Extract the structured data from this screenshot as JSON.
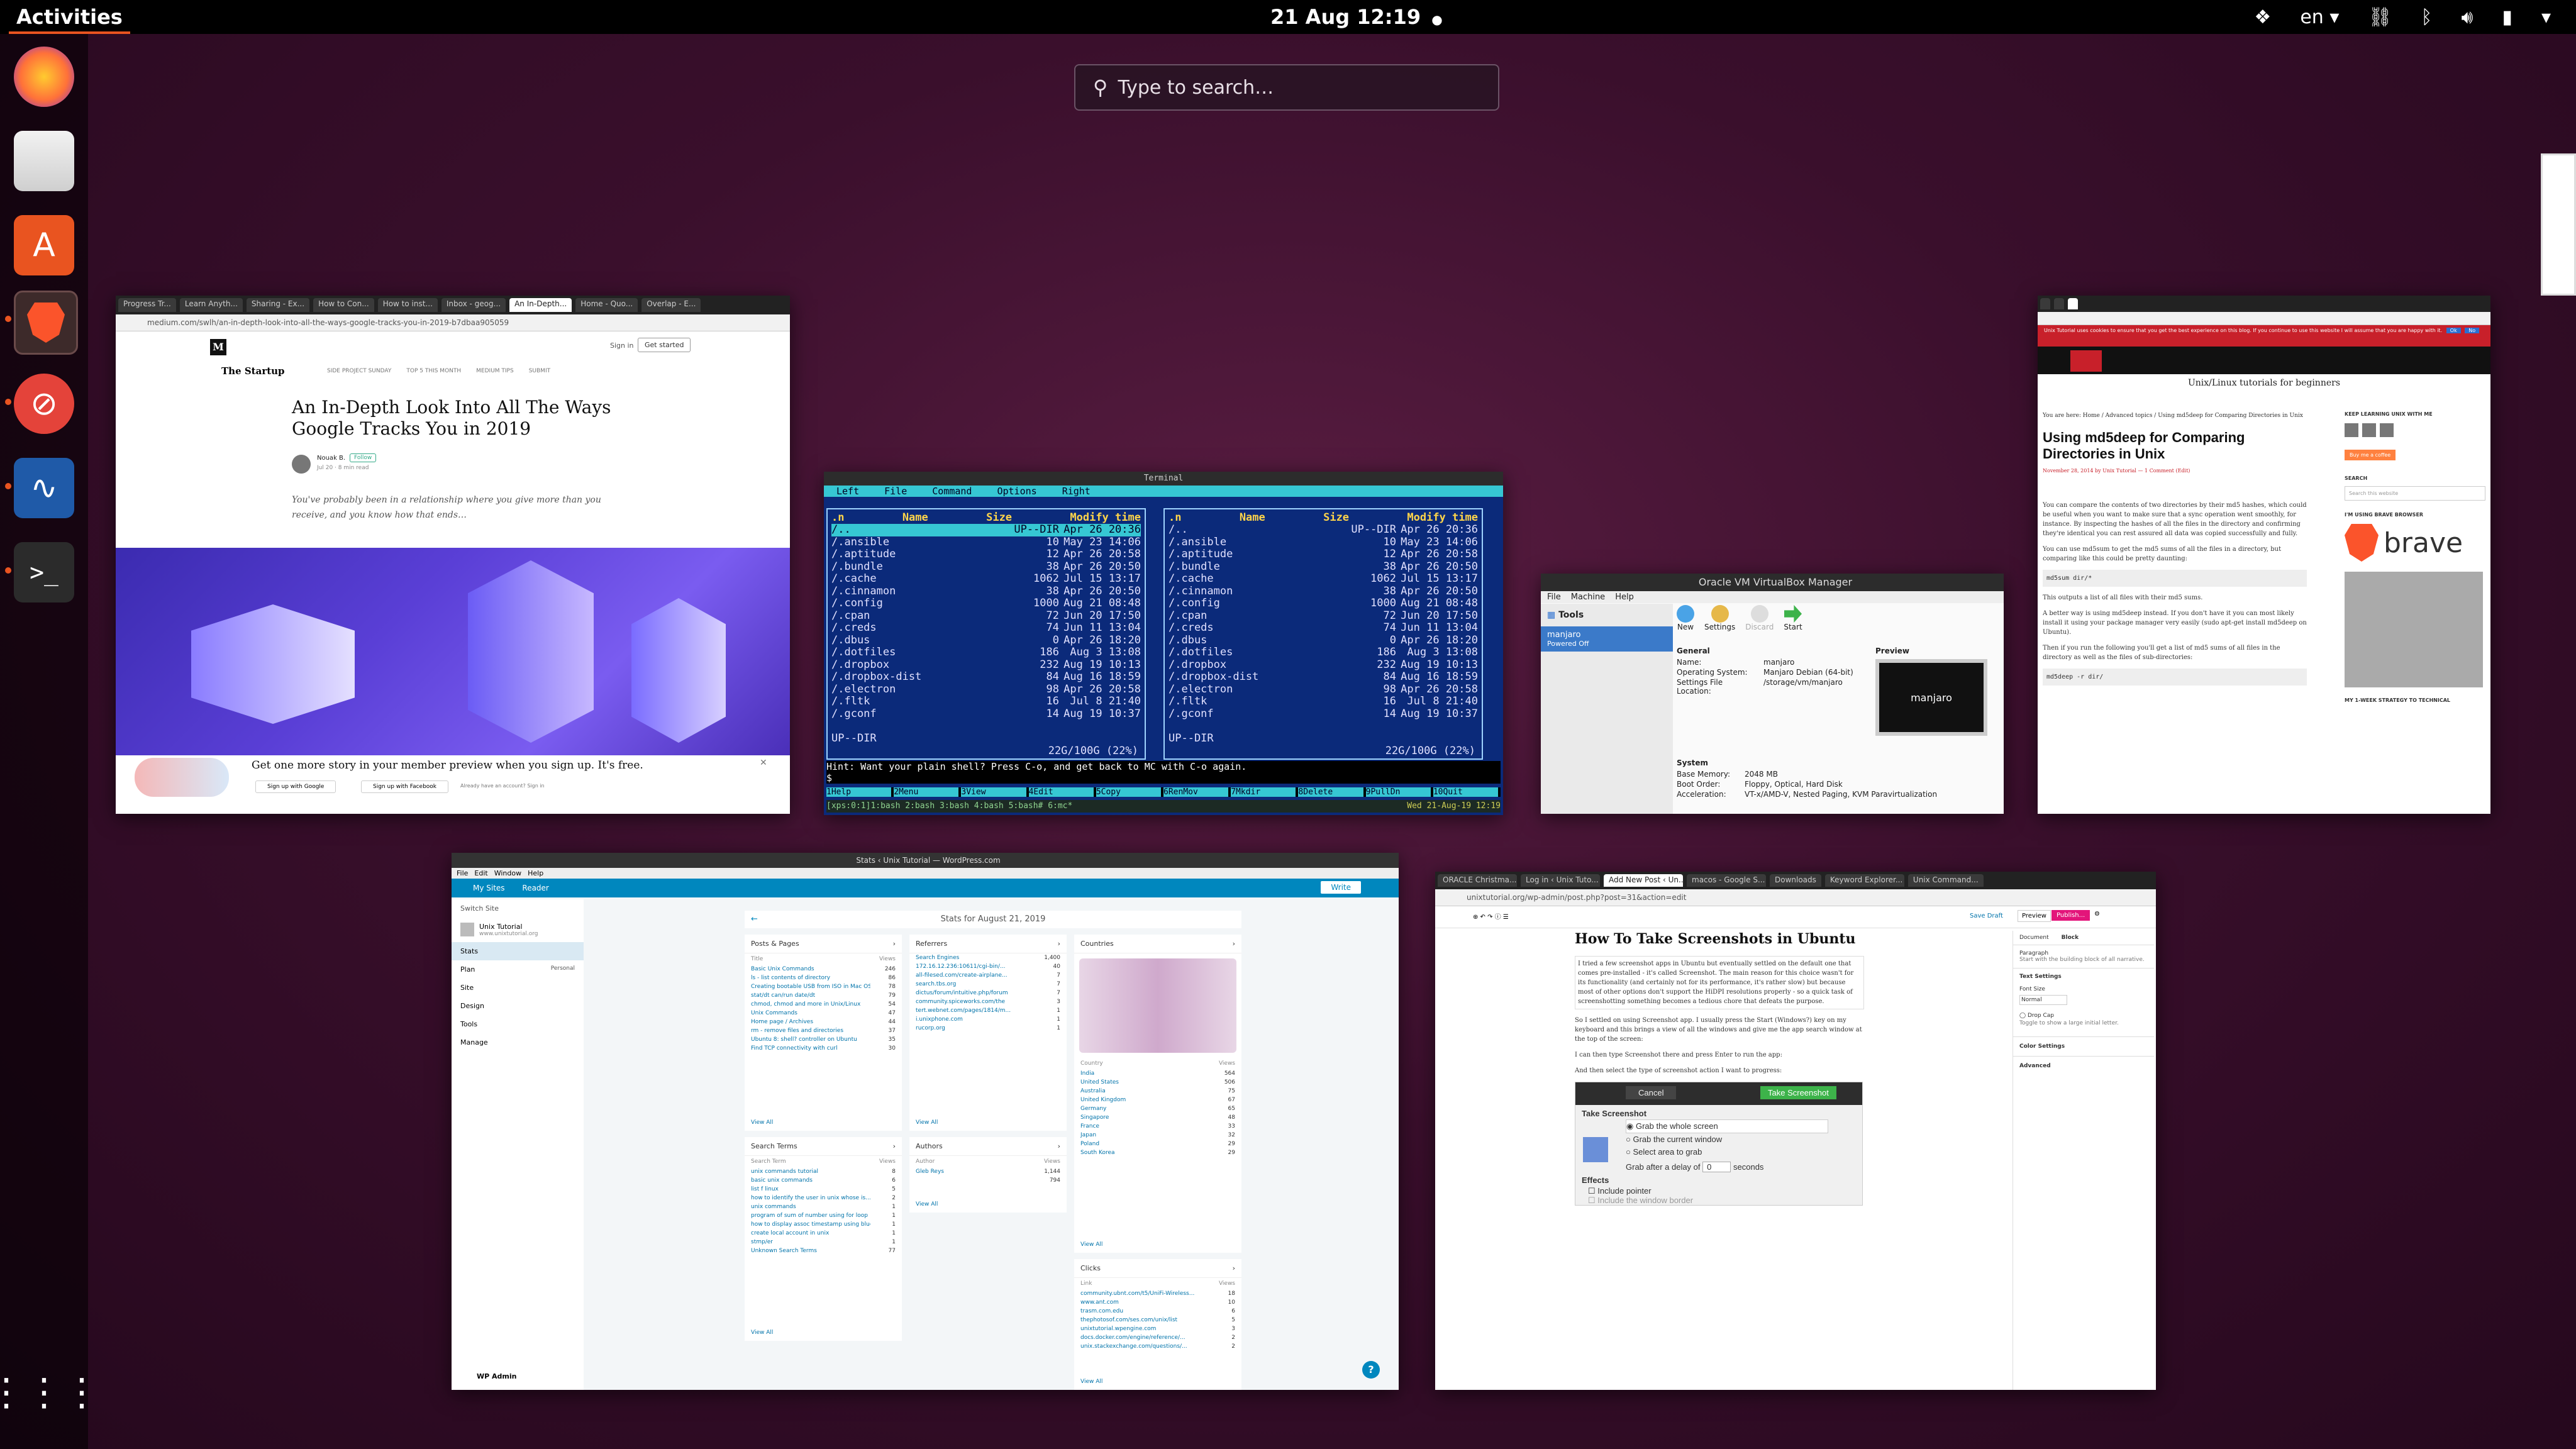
{
  "topbar": {
    "activities": "Activities",
    "clock": "21 Aug  12:19",
    "language": "en"
  },
  "search": {
    "placeholder": "Type to search…"
  },
  "dock": {
    "apps": [
      "firefox-icon",
      "files-icon",
      "software-icon",
      "brave-icon",
      "blocked-icon",
      "system-monitor-icon",
      "terminal-icon"
    ],
    "show_apps": "apps-grid-icon"
  },
  "medium_window": {
    "tabs": [
      "Progress Tr...",
      "Learn Anyth...",
      "Sharing - Ex...",
      "How to Con...",
      "How to inst...",
      "Inbox - geog...",
      "An In-Depth...",
      "Home - Quo...",
      "Overlap - E..."
    ],
    "url": "medium.com/swlh/an-in-depth-look-into-all-the-ways-google-tracks-you-in-2019-b7dbaa905059",
    "brand": "M",
    "publication": "The Startup",
    "nav": [
      "SIDE PROJECT SUNDAY",
      "TOP 5 THIS MONTH",
      "MEDIUM TIPS",
      "SUBMIT"
    ],
    "signin": "Sign in",
    "getstarted": "Get started",
    "title": "An In-Depth Look Into All The Ways Google Tracks You in 2019",
    "author": "Nouak B.",
    "follow": "Follow",
    "meta": "Jul 20 · 8 min read",
    "intro": "You've probably been in a relationship where you give more than you receive, and you know how that ends…",
    "banner": "Get one more story in your member preview when you sign up. It's free.",
    "google_btn": "Sign up with Google",
    "fb_btn": "Sign up with Facebook",
    "already": "Already have an account? Sign in"
  },
  "terminal": {
    "title": "Terminal",
    "menu": [
      "Left",
      "File",
      "Command",
      "Options",
      "Right"
    ],
    "headers": [
      ".n",
      "Name",
      "Size",
      "Modify time"
    ],
    "rows": [
      [
        "/..",
        "UP--DIR",
        "Apr 26 20:36"
      ],
      [
        "/.ansible",
        "10",
        "May 23 14:06"
      ],
      [
        "/.aptitude",
        "12",
        "Apr 26 20:58"
      ],
      [
        "/.bundle",
        "38",
        "Apr 26 20:50"
      ],
      [
        "/.cache",
        "1062",
        "Jul 15 13:17"
      ],
      [
        "/.cinnamon",
        "38",
        "Apr 26 20:50"
      ],
      [
        "/.config",
        "1000",
        "Aug 21 08:48"
      ],
      [
        "/.cpan",
        "72",
        "Jun 20 17:50"
      ],
      [
        "/.creds",
        "74",
        "Jun 11 13:04"
      ],
      [
        "/.dbus",
        "0",
        "Apr 26 18:20"
      ],
      [
        "/.dotfiles",
        "186",
        "Aug  3 13:08"
      ],
      [
        "/.dropbox",
        "232",
        "Aug 19 10:13"
      ],
      [
        "/.dropbox-dist",
        "84",
        "Aug 16 18:59"
      ],
      [
        "/.electron",
        "98",
        "Apr 26 20:58"
      ],
      [
        "/.fltk",
        "16",
        "Jul  8 21:40"
      ],
      [
        "/.gconf",
        "14",
        "Aug 19 10:37"
      ]
    ],
    "status_left": "UP--DIR",
    "disk": "22G/100G (22%)",
    "hint": "Hint: Want your plain shell? Press C-o, and get back to MC with C-o again.",
    "prompt": "$ ",
    "fkeys": [
      "1Help",
      "2Menu",
      "3View",
      "4Edit",
      "5Copy",
      "6RenMov",
      "7Mkdir",
      "8Delete",
      "9PullDn",
      "10Quit"
    ],
    "tmux": "[xps:0:1]1:bash  2:bash  3:bash  4:bash  5:bash#  6:mc*",
    "tmux_time": "Wed 21-Aug-19 12:19"
  },
  "virtualbox": {
    "title": "Oracle VM VirtualBox Manager",
    "menu": [
      "File",
      "Machine",
      "Help"
    ],
    "tools": "Tools",
    "toolbar": [
      "New",
      "Settings",
      "Discard",
      "Start"
    ],
    "vm_name": "manjaro",
    "vm_state": "Powered Off",
    "general": "General",
    "fields": [
      [
        "Name:",
        "manjaro"
      ],
      [
        "Operating System:",
        "Manjaro Debian (64-bit)"
      ],
      [
        "Settings File Location:",
        "/storage/vm/manjaro"
      ]
    ],
    "preview": "Preview",
    "system": "System",
    "sys_fields": [
      [
        "Base Memory:",
        "2048 MB"
      ],
      [
        "Boot Order:",
        "Floppy, Optical, Hard Disk"
      ],
      [
        "Acceleration:",
        "VT-x/AMD-V, Nested Paging, KVM Paravirtualization"
      ]
    ]
  },
  "unix_window": {
    "site_title": "Unix/Linux tutorials for beginners",
    "cookie": "Unix Tutorial uses cookies to ensure that you get the best experience on this blog. If you continue to use this website I will assume that you are happy with it.",
    "ok": "Ok",
    "no": "No",
    "breadcrumb": "You are here: Home / Advanced topics / Using md5deep for Comparing Directories in Unix",
    "title": "Using md5deep for Comparing Directories in Unix",
    "byline": "November 28, 2014 by Unix Tutorial — 1 Comment (Edit)",
    "p1": "You can compare the contents of two directories by their md5 hashes, which could be useful when you want to make sure that a sync operation went smoothly, for instance. By inspecting the hashes of all the files in the directory and confirming they're identical you can rest assured all data was copied successfully and fully.",
    "p2": "You can use md5sum to get the md5 sums of all the files in a directory, but comparing like this could be pretty daunting:",
    "code1": "md5sum dir/*",
    "p3": "This outputs a list of all files with their md5 sums.",
    "p4": "A better way is using md5deep instead. If you don't have it you can most likely install it using your package manager very easily (sudo apt-get install md5deep on Ubuntu).",
    "p5": "Then if you run the following you'll get a list of md5 sums of all files in the directory as well as the files of sub-directories:",
    "code2": "md5deep -r dir/",
    "side_learn": "KEEP LEARNING UNIX WITH ME",
    "coffee": "Buy me a coffee",
    "search": "SEARCH",
    "search_ph": "Search this website",
    "brave_label": "I'M USING BRAVE BROWSER",
    "brave": "brave",
    "strategy": "MY 1-WEEK STRATEGY TO TECHNICAL"
  },
  "wp_stats": {
    "window_title": "Stats ‹ Unix Tutorial — WordPress.com",
    "menu": [
      "File",
      "Edit",
      "Window",
      "Help"
    ],
    "mysites": "My Sites",
    "reader": "Reader",
    "write": "Write",
    "switch": "Switch Site",
    "site_name": "Unix Tutorial",
    "site_url": "www.unixtutorial.org",
    "nav": [
      "Stats",
      "Plan",
      "Site",
      "Design",
      "Tools",
      "Manage"
    ],
    "plan_badge": "Personal",
    "wp_admin": "WP Admin",
    "stats_title": "Stats for August 21, 2019",
    "posts_title": "Posts & Pages",
    "posts_head": [
      "Title",
      "Views"
    ],
    "posts": [
      [
        "Basic Unix Commands",
        "246"
      ],
      [
        "ls - list contents of directory",
        "86"
      ],
      [
        "Creating bootable USB from ISO in Mac OS",
        "78"
      ],
      [
        "stat/dt can/run date/dt",
        "79"
      ],
      [
        "chmod, chmod and more in Unix/Linux",
        "54"
      ],
      [
        "Unix Commands",
        "47"
      ],
      [
        "Home page / Archives",
        "44"
      ],
      [
        "rm - remove files and directories",
        "37"
      ],
      [
        "Ubuntu 8: shell? controller on Ubuntu",
        "35"
      ],
      [
        "Find TCP connectivity with curl",
        "30"
      ]
    ],
    "referrers_title": "Referrers",
    "referrers": [
      [
        "Search Engines",
        "1,400"
      ],
      [
        "172.16.12.236:10611/cgi-bin/...",
        "40"
      ],
      [
        "all-filesed.com/create-airplane...",
        "7"
      ],
      [
        "search.tbs.org",
        "7"
      ],
      [
        "dictus/forum/intuitive.php/forum",
        "7"
      ],
      [
        "community.spiceworks.com/the",
        "3"
      ],
      [
        "tert.webnet.com/pages/1814/m...",
        "1"
      ],
      [
        "i.unixphone.com",
        "1"
      ],
      [
        "rucorp.org",
        "1"
      ]
    ],
    "countries_title": "Countries",
    "countries_head": [
      "Country",
      "Views"
    ],
    "countries": [
      [
        "India",
        "564"
      ],
      [
        "United States",
        "506"
      ],
      [
        "Australia",
        "75"
      ],
      [
        "United Kingdom",
        "67"
      ],
      [
        "Germany",
        "65"
      ],
      [
        "Singapore",
        "48"
      ],
      [
        "France",
        "33"
      ],
      [
        "Japan",
        "32"
      ],
      [
        "Poland",
        "29"
      ],
      [
        "South Korea",
        "29"
      ]
    ],
    "search_terms_title": "Search Terms",
    "search_terms_head": [
      "Search Term",
      "Views"
    ],
    "search_terms": [
      [
        "unix commands tutorial",
        "8"
      ],
      [
        "basic unix commands",
        "6"
      ],
      [
        "list f linux",
        "5"
      ],
      [
        "how to identify the user in unix whose is...",
        "2"
      ],
      [
        "unix commands",
        "1"
      ],
      [
        "program of sum of number using for loop",
        "1"
      ],
      [
        "how to display assoc timestamp using bluer",
        "1"
      ],
      [
        "create local account in unix",
        "1"
      ],
      [
        "stmp/er",
        "1"
      ],
      [
        "Unknown Search Terms",
        "77"
      ]
    ],
    "authors_title": "Authors",
    "authors_head": [
      "Author",
      "Views"
    ],
    "authors": [
      [
        "Gleb Reys",
        "1,144"
      ],
      [
        "",
        "794"
      ]
    ],
    "clicks_title": "Clicks",
    "clicks_head": [
      "Link",
      "Views"
    ],
    "clicks": [
      [
        "community.ubnt.com/t5/UniFi-Wireless...",
        "18"
      ],
      [
        "www.ant.com",
        "10"
      ],
      [
        "trasm.com.edu",
        "6"
      ],
      [
        "thephotosof.com/ses.com/unix/list",
        "5"
      ],
      [
        "unixtutorial.wpengine.com",
        "3"
      ],
      [
        "docs.docker.com/engine/reference/...",
        "2"
      ],
      [
        "unix.stackexchange.com/questions/...",
        "2"
      ]
    ],
    "view_all": "View All"
  },
  "wp_editor": {
    "tabs": [
      "ORACLE Christma...",
      "Log in ‹ Unix Tuto...",
      "Add New Post ‹ Un...",
      "macos - Google S...",
      "Downloads",
      "Keyword Explorer...",
      "Unix Command..."
    ],
    "url": "unixtutorial.org/wp-admin/post.php?post=31&action=edit",
    "save_draft": "Save Draft",
    "preview": "Preview",
    "publish": "Publish...",
    "title": "How To Take Screenshots in Ubuntu",
    "p1": "I tried a few screenshot apps in Ubuntu but eventually settled on the default one that comes pre-installed - it's called Screenshot. The main reason for this choice wasn't for its functionality (and certainly not for its performance, it's rather slow) but because most of other options don't support the HiDPI resolutions properly - so a quick task of screenshotting something becomes a tedious chore that defeats the purpose.",
    "p2": "So I settled on using Screenshot app. I usually press the Start (Windows?) key on my keyboard and this brings a view of all the windows and give me the app search window at the top of the screen:",
    "p3": "I can then type Screenshot there and press Enter to run the app:",
    "p4": "And then select the type of screenshot action I want to progress:",
    "sidebar_tabs": [
      "Document",
      "Block"
    ],
    "paragraph": "Paragraph",
    "paragraph_desc": "Start with the building block of all narrative.",
    "text_settings": "Text Settings",
    "font_size": "Font Size",
    "font_size_val": "Normal",
    "drop_cap": "Drop Cap",
    "drop_cap_desc": "Toggle to show a large initial letter.",
    "color_settings": "Color Settings",
    "advanced": "Advanced",
    "shot": {
      "cancel": "Cancel",
      "take": "Take Screenshot",
      "heading": "Take Screenshot",
      "options": [
        "Grab the whole screen",
        "Grab the current window",
        "Select area to grab"
      ],
      "delay_label": "Grab after a delay of",
      "delay_value": "0",
      "seconds": "seconds",
      "effects": "Effects",
      "pointer": "Include pointer",
      "border": "Include the window border"
    }
  }
}
